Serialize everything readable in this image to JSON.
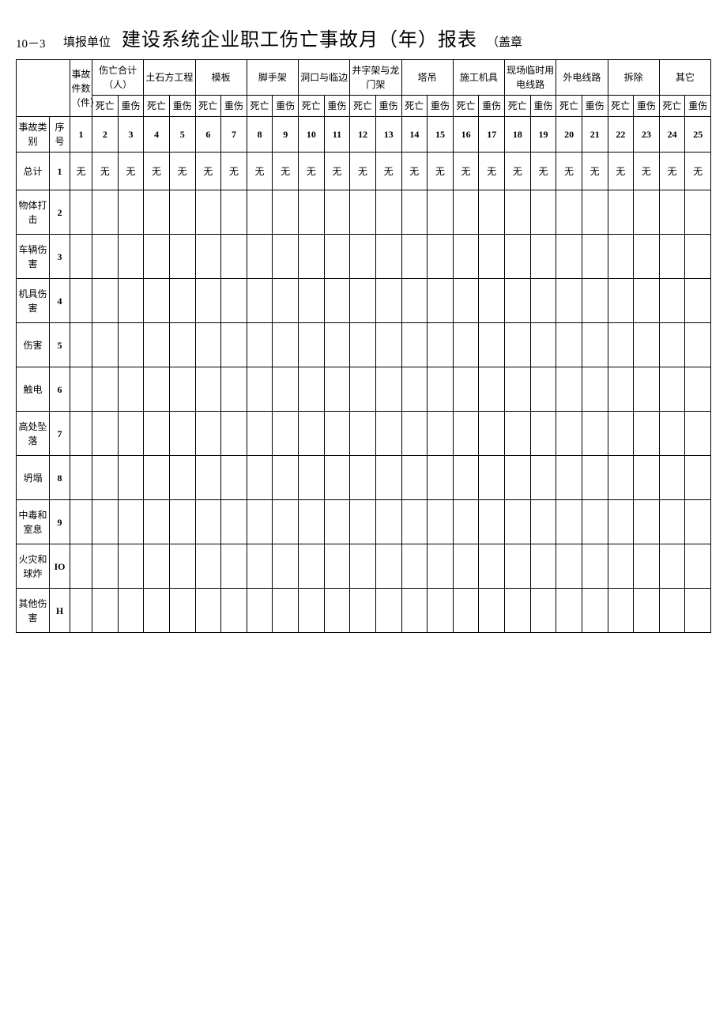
{
  "header": {
    "form_no": "10－3",
    "unit_label": "填报单位",
    "title": "建设系统企业职工伤亡事故月（年）报表",
    "stamp": "（盖章"
  },
  "groups": [
    {
      "name": "事故件数（件）",
      "sub": null
    },
    {
      "name": "伤亡合计（人）",
      "sub": [
        "死亡",
        "重伤"
      ]
    },
    {
      "name": "土石方工程",
      "sub": [
        "死亡",
        "重伤"
      ]
    },
    {
      "name": "模板",
      "sub": [
        "死亡",
        "重伤"
      ]
    },
    {
      "name": "脚手架",
      "sub": [
        "死亡",
        "重伤"
      ]
    },
    {
      "name": "洞口与临边",
      "sub": [
        "死亡",
        "重伤"
      ]
    },
    {
      "name": "井字架与龙门架",
      "sub": [
        "死亡",
        "重伤"
      ]
    },
    {
      "name": "塔吊",
      "sub": [
        "死亡",
        "重伤"
      ]
    },
    {
      "name": "施工机具",
      "sub": [
        "死亡",
        "重伤"
      ]
    },
    {
      "name": "现场临时用电线路",
      "sub": [
        "死亡",
        "重伤"
      ]
    },
    {
      "name": "外电线路",
      "sub": [
        "死亡",
        "重伤"
      ]
    },
    {
      "name": "拆除",
      "sub": [
        "死亡",
        "重伤"
      ]
    },
    {
      "name": "其它",
      "sub": [
        "死亡",
        "重伤"
      ]
    }
  ],
  "row_header_labels": {
    "category": "事故类别",
    "seq": "序号"
  },
  "col_numbers": [
    "1",
    "2",
    "3",
    "4",
    "5",
    "6",
    "7",
    "8",
    "9",
    "10",
    "11",
    "12",
    "13",
    "14",
    "15",
    "16",
    "17",
    "18",
    "19",
    "20",
    "21",
    "22",
    "23",
    "24",
    "25"
  ],
  "rows": [
    {
      "label": "总计",
      "seq": "1",
      "values": [
        "无",
        "无",
        "无",
        "无",
        "无",
        "无",
        "无",
        "无",
        "无",
        "无",
        "无",
        "无",
        "无",
        "无",
        "无",
        "无",
        "无",
        "无",
        "无",
        "无",
        "无",
        "无",
        "无",
        "无",
        "无"
      ]
    },
    {
      "label": "物体打击",
      "seq": "2",
      "values": [
        "",
        "",
        "",
        "",
        "",
        "",
        "",
        "",
        "",
        "",
        "",
        "",
        "",
        "",
        "",
        "",
        "",
        "",
        "",
        "",
        "",
        "",
        "",
        "",
        ""
      ]
    },
    {
      "label": "车辆伤害",
      "seq": "3",
      "values": [
        "",
        "",
        "",
        "",
        "",
        "",
        "",
        "",
        "",
        "",
        "",
        "",
        "",
        "",
        "",
        "",
        "",
        "",
        "",
        "",
        "",
        "",
        "",
        "",
        ""
      ]
    },
    {
      "label": "机具伤害",
      "seq": "4",
      "values": [
        "",
        "",
        "",
        "",
        "",
        "",
        "",
        "",
        "",
        "",
        "",
        "",
        "",
        "",
        "",
        "",
        "",
        "",
        "",
        "",
        "",
        "",
        "",
        "",
        ""
      ]
    },
    {
      "label": "伤害",
      "seq": "5",
      "values": [
        "",
        "",
        "",
        "",
        "",
        "",
        "",
        "",
        "",
        "",
        "",
        "",
        "",
        "",
        "",
        "",
        "",
        "",
        "",
        "",
        "",
        "",
        "",
        "",
        ""
      ]
    },
    {
      "label": "触电",
      "seq": "6",
      "values": [
        "",
        "",
        "",
        "",
        "",
        "",
        "",
        "",
        "",
        "",
        "",
        "",
        "",
        "",
        "",
        "",
        "",
        "",
        "",
        "",
        "",
        "",
        "",
        "",
        ""
      ]
    },
    {
      "label": "高处坠落",
      "seq": "7",
      "values": [
        "",
        "",
        "",
        "",
        "",
        "",
        "",
        "",
        "",
        "",
        "",
        "",
        "",
        "",
        "",
        "",
        "",
        "",
        "",
        "",
        "",
        "",
        "",
        "",
        ""
      ]
    },
    {
      "label": "坍塌",
      "seq": "8",
      "values": [
        "",
        "",
        "",
        "",
        "",
        "",
        "",
        "",
        "",
        "",
        "",
        "",
        "",
        "",
        "",
        "",
        "",
        "",
        "",
        "",
        "",
        "",
        "",
        "",
        ""
      ]
    },
    {
      "label": "中毒和室息",
      "seq": "9",
      "values": [
        "",
        "",
        "",
        "",
        "",
        "",
        "",
        "",
        "",
        "",
        "",
        "",
        "",
        "",
        "",
        "",
        "",
        "",
        "",
        "",
        "",
        "",
        "",
        "",
        ""
      ]
    },
    {
      "label": "火灾和球炸",
      "seq": "IO",
      "values": [
        "",
        "",
        "",
        "",
        "",
        "",
        "",
        "",
        "",
        "",
        "",
        "",
        "",
        "",
        "",
        "",
        "",
        "",
        "",
        "",
        "",
        "",
        "",
        "",
        ""
      ]
    },
    {
      "label": "其他伤害",
      "seq": "H",
      "values": [
        "",
        "",
        "",
        "",
        "",
        "",
        "",
        "",
        "",
        "",
        "",
        "",
        "",
        "",
        "",
        "",
        "",
        "",
        "",
        "",
        "",
        "",
        "",
        "",
        ""
      ]
    }
  ]
}
